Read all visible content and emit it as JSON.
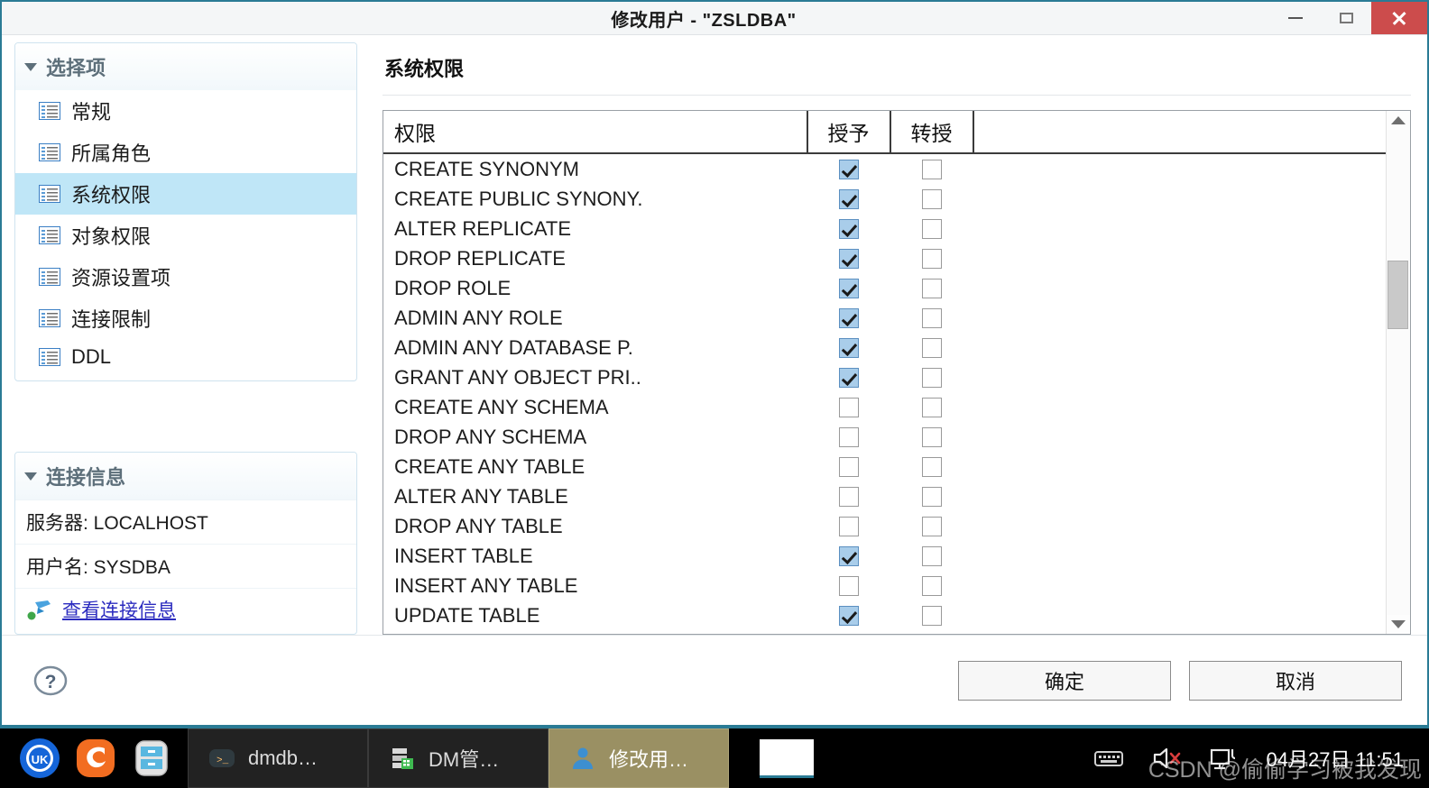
{
  "window": {
    "title": "修改用户 - \"ZSLDBA\"",
    "controls": {
      "minimize": "—",
      "maximize": "□",
      "close": "✕"
    }
  },
  "sidebar": {
    "options_group": {
      "label": "选择项"
    },
    "items": [
      {
        "label": "常规",
        "selected": false
      },
      {
        "label": "所属角色",
        "selected": false
      },
      {
        "label": "系统权限",
        "selected": true
      },
      {
        "label": "对象权限",
        "selected": false
      },
      {
        "label": "资源设置项",
        "selected": false
      },
      {
        "label": "连接限制",
        "selected": false
      },
      {
        "label": "DDL",
        "selected": false
      }
    ],
    "connection_group": {
      "label": "连接信息"
    },
    "connection": {
      "server": "服务器: LOCALHOST",
      "username": "用户名: SYSDBA",
      "view_link": "查看连接信息"
    }
  },
  "main": {
    "heading": "系统权限",
    "table": {
      "headers": [
        "权限",
        "授予",
        "转授"
      ],
      "rows": [
        {
          "name": "CREATE SYNONYM",
          "grant": true,
          "delegate": false
        },
        {
          "name": "CREATE PUBLIC SYNONY.",
          "grant": true,
          "delegate": false
        },
        {
          "name": "ALTER REPLICATE",
          "grant": true,
          "delegate": false
        },
        {
          "name": "DROP REPLICATE",
          "grant": true,
          "delegate": false
        },
        {
          "name": "DROP ROLE",
          "grant": true,
          "delegate": false
        },
        {
          "name": "ADMIN ANY ROLE",
          "grant": true,
          "delegate": false
        },
        {
          "name": "ADMIN ANY DATABASE P.",
          "grant": true,
          "delegate": false
        },
        {
          "name": "GRANT ANY OBJECT PRI..",
          "grant": true,
          "delegate": false
        },
        {
          "name": "CREATE ANY SCHEMA",
          "grant": false,
          "delegate": false
        },
        {
          "name": "DROP ANY SCHEMA",
          "grant": false,
          "delegate": false
        },
        {
          "name": "CREATE ANY TABLE",
          "grant": false,
          "delegate": false
        },
        {
          "name": "ALTER ANY TABLE",
          "grant": false,
          "delegate": false
        },
        {
          "name": "DROP ANY TABLE",
          "grant": false,
          "delegate": false
        },
        {
          "name": "INSERT TABLE",
          "grant": true,
          "delegate": false
        },
        {
          "name": "INSERT ANY TABLE",
          "grant": false,
          "delegate": false
        },
        {
          "name": "UPDATE TABLE",
          "grant": true,
          "delegate": false
        }
      ]
    },
    "scrollbar": {
      "thumb_top_pct": 27,
      "thumb_height_pct": 14
    }
  },
  "footer": {
    "help": "?",
    "ok_label": "确定",
    "cancel_label": "取消"
  },
  "taskbar": {
    "launchers": [
      "ukui-start-icon",
      "firefox-icon",
      "file-manager-icon"
    ],
    "tasks": [
      {
        "label": "dmdb…",
        "icon": "terminal-icon",
        "active": false
      },
      {
        "label": "DM管…",
        "icon": "dm-manager-icon",
        "active": false
      },
      {
        "label": "修改用…",
        "icon": "user-icon",
        "active": true
      }
    ],
    "tray": [
      "keyboard-icon",
      "volume-muted-icon",
      "display-icon"
    ],
    "clock": "04月27日 11:51",
    "watermark": "CSDN @偷偷学习被我发现"
  },
  "colors": {
    "accent_border": "#2a7b95",
    "selection": "#bfe6f7",
    "close_red": "#cc4c4c",
    "checkbox_on": "#a9cdea",
    "link": "#2b2bbf",
    "task_active": "#9a9063"
  }
}
